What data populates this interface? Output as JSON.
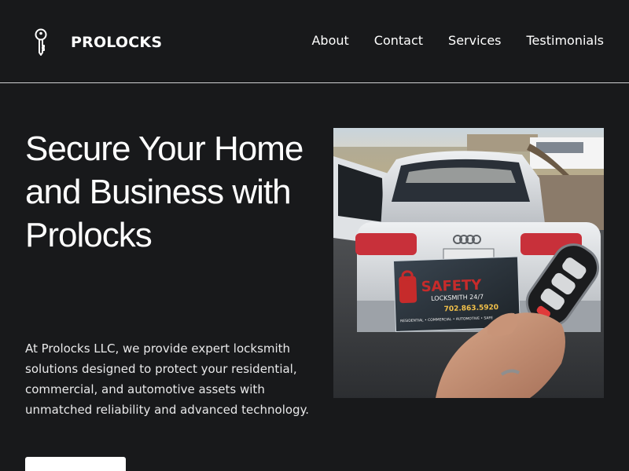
{
  "brand": {
    "name": "PROLOCKS",
    "icon": "key-icon"
  },
  "nav": {
    "items": [
      {
        "label": "About"
      },
      {
        "label": "Contact"
      },
      {
        "label": "Services"
      },
      {
        "label": "Testimonials"
      }
    ]
  },
  "hero": {
    "title": "Secure Your Home and Business with Prolocks",
    "description": "At Prolocks LLC, we provide expert locksmith solutions designed to protect your residential, commercial, and automotive assets with unmatched reliability and advanced technology.",
    "cta_label": ""
  },
  "photo": {
    "card_brand": "SAFETY",
    "card_sub": "LOCKSMITH 24/7",
    "card_phone": "702.863.5920",
    "card_services": "RESIDENTIAL • COMMERCIAL • AUTOMOTIVE • SAFE"
  },
  "colors": {
    "background": "#18191b",
    "text": "#ffffff",
    "divider": "#cfd0d2"
  }
}
